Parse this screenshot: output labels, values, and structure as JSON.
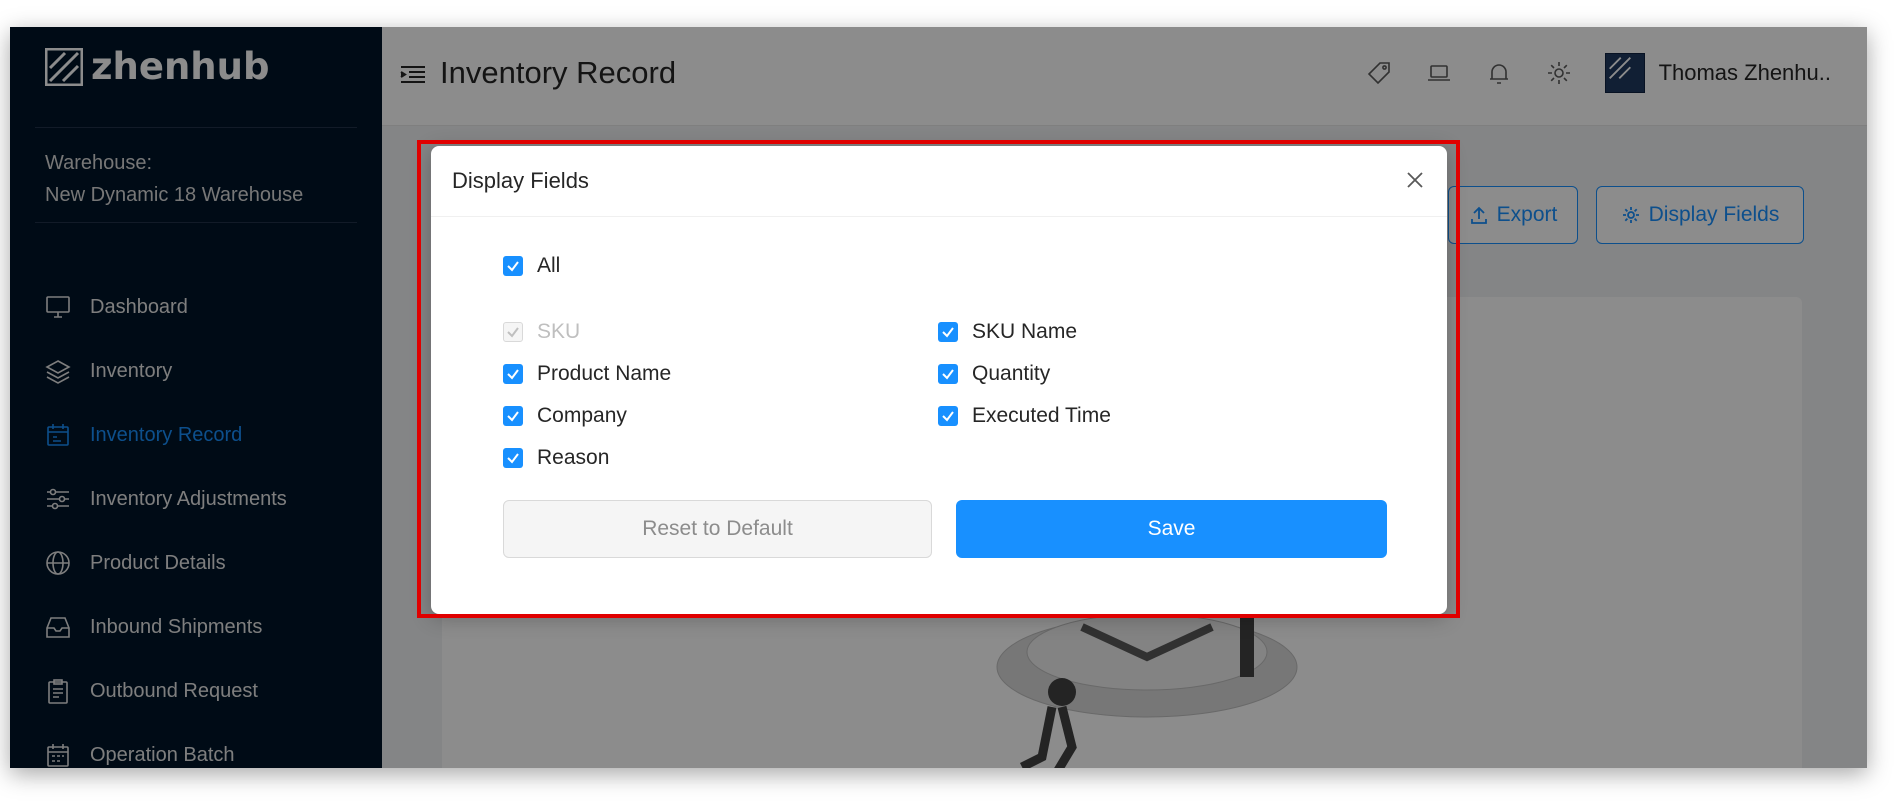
{
  "app": {
    "logo_text": "zhenhub"
  },
  "sidebar": {
    "warehouse_label": "Warehouse:",
    "warehouse_name": "New Dynamic 18 Warehouse",
    "items": [
      {
        "label": "Dashboard",
        "icon": "monitor-icon"
      },
      {
        "label": "Inventory",
        "icon": "layers-icon"
      },
      {
        "label": "Inventory Record",
        "icon": "calendar-icon",
        "active": true
      },
      {
        "label": "Inventory Adjustments",
        "icon": "sliders-icon"
      },
      {
        "label": "Product Details",
        "icon": "globe-icon"
      },
      {
        "label": "Inbound Shipments",
        "icon": "inbox-icon"
      },
      {
        "label": "Outbound Request",
        "icon": "clipboard-icon"
      },
      {
        "label": "Operation Batch",
        "icon": "batch-icon"
      }
    ]
  },
  "header": {
    "title": "Inventory Record",
    "user_name": "Thomas Zhenhu..",
    "icons": [
      "tag-icon",
      "laptop-icon",
      "bell-icon",
      "gear-icon"
    ]
  },
  "toolbar": {
    "export_label": "Export",
    "display_fields_label": "Display Fields"
  },
  "modal": {
    "title": "Display Fields",
    "all_label": "All",
    "fields": [
      {
        "label": "SKU",
        "checked": true,
        "disabled": true
      },
      {
        "label": "SKU Name",
        "checked": true,
        "disabled": false
      },
      {
        "label": "Product Name",
        "checked": true,
        "disabled": false
      },
      {
        "label": "Quantity",
        "checked": true,
        "disabled": false
      },
      {
        "label": "Company",
        "checked": true,
        "disabled": false
      },
      {
        "label": "Executed Time",
        "checked": true,
        "disabled": false
      },
      {
        "label": "Reason",
        "checked": true,
        "disabled": false
      }
    ],
    "reset_label": "Reset to Default",
    "save_label": "Save"
  },
  "colors": {
    "primary": "#1890ff",
    "sidebar_bg": "#001529",
    "highlight": "#e00000"
  }
}
